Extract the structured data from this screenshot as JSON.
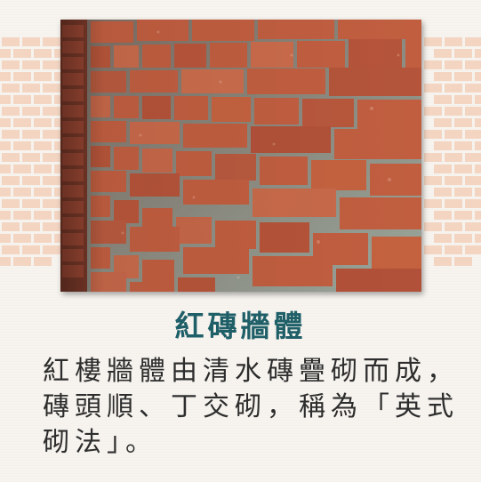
{
  "title": "紅磚牆體",
  "description_lines": [
    "紅樓牆體由清水磚疊砌而成，",
    "磚頭順、丁交砌，稱為「英式",
    "砌法」。"
  ],
  "colors": {
    "title": "#1f5f68",
    "text": "#2d2d2d",
    "brick": "#b85a3f",
    "mortar": "#8f9a90",
    "motif": "#f0b89a"
  }
}
